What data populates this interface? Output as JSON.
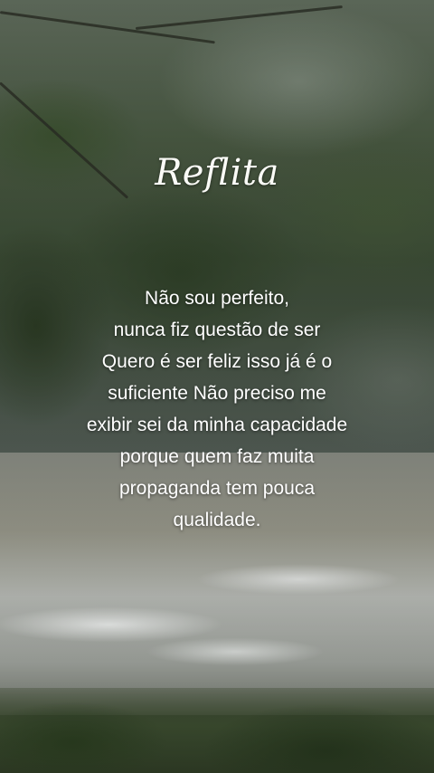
{
  "title": "Reflita",
  "quote_lines": [
    "Não sou perfeito,",
    "nunca fiz questão de ser",
    "Quero é ser feliz isso já é o",
    "suficiente Não preciso me",
    "exibir sei da minha capacidade",
    "porque quem faz muita",
    "propaganda tem pouca",
    "qualidade."
  ]
}
